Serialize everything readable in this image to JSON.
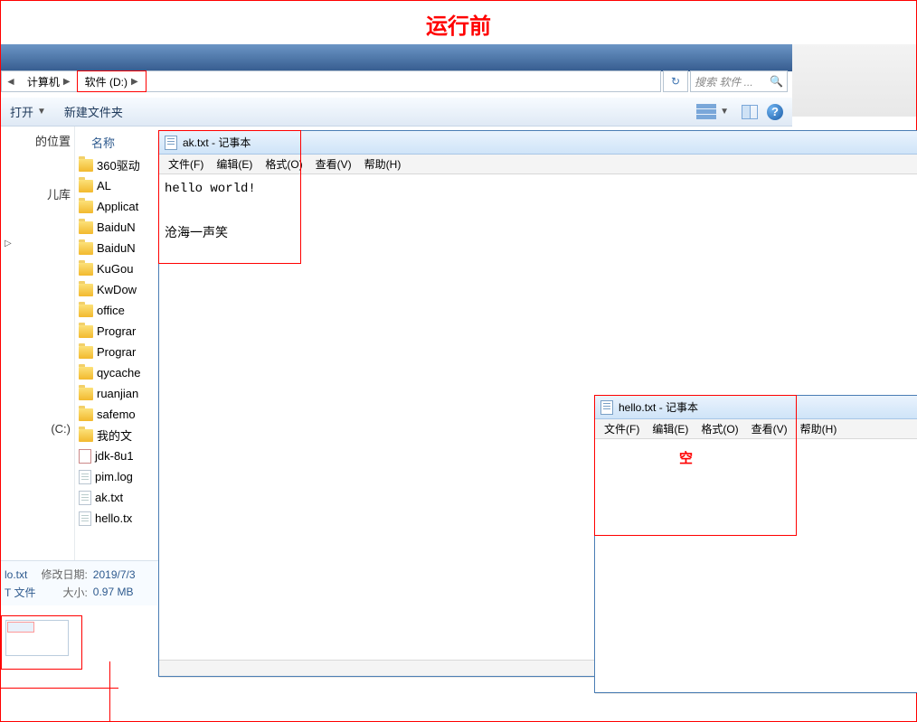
{
  "page_title": "运行前",
  "breadcrumb": {
    "seg1": "计算机",
    "seg2": "软件 (D:)"
  },
  "search": {
    "placeholder": "搜索 软件 ..."
  },
  "toolbar": {
    "open": "打开",
    "new_folder": "新建文件夹"
  },
  "sidebar": {
    "places": "的位置",
    "libs": "儿库",
    "expand": "",
    "computer_c": "(C:)",
    "drive_d": ""
  },
  "files": {
    "header": "名称",
    "items": [
      "360驱动",
      "AL",
      "Applicat",
      "BaiduN",
      "BaiduN",
      "KuGou",
      "KwDow",
      "office",
      "Prograr",
      "Prograr",
      "qycache",
      "ruanjian",
      "safemo",
      "我的文",
      "jdk-8u1",
      "pim.log",
      "ak.txt",
      "hello.tx"
    ]
  },
  "details": {
    "name": "lo.txt",
    "type": "T 文件",
    "mod_label": "修改日期:",
    "mod_val": "2019/7/3",
    "size_label": "大小:",
    "size_val": "0.97 MB"
  },
  "notepad1": {
    "title": "ak.txt - 记事本",
    "menus": {
      "file": "文件(F)",
      "edit": "编辑(E)",
      "format": "格式(O)",
      "view": "查看(V)",
      "help": "帮助(H)"
    },
    "content": "hello world!\n\n沧海一声笑"
  },
  "notepad2": {
    "title": "hello.txt - 记事本",
    "menus": {
      "file": "文件(F)",
      "edit": "编辑(E)",
      "format": "格式(O)",
      "view": "查看(V)",
      "help": "帮助(H)"
    },
    "content": ""
  },
  "empty_label": "空"
}
